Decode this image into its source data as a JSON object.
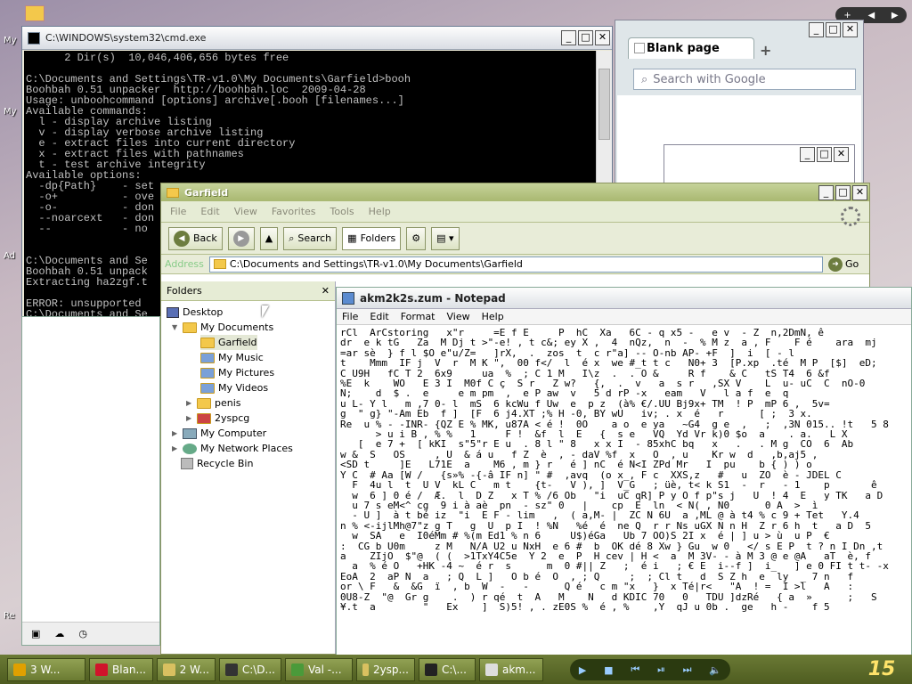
{
  "desktop": {
    "labels": [
      "My",
      "My",
      "Ad",
      "Re"
    ]
  },
  "cmd": {
    "title": "C:\\WINDOWS\\system32\\cmd.exe",
    "lines": [
      "      2 Dir(s)  10,046,406,656 bytes free",
      "",
      "C:\\Documents and Settings\\TR-v1.0\\My Documents\\Garfield>booh",
      "Boohbah 0.51 unpacker  http://boohbah.loc  2009-04-28",
      "Usage: unboohcommand [options] archive[.booh [filenames...]",
      "Available commands:",
      "  l - display archive listing",
      "  v - display verbose archive listing",
      "  e - extract files into current directory",
      "  x - extract files with pathnames",
      "  t - test archive integrity",
      "Available options:",
      "  -dp{Path}    - set",
      "  -o+          - ove",
      "  -o-          - don",
      "  --noarcext   - don",
      "  --           - no ",
      "",
      "",
      "C:\\Documents and Se",
      "Boohbah 0.51 unpack",
      "Extracting ha2zgf.t",
      "",
      "ERROR: unsupported",
      "C:\\Documents and Se"
    ]
  },
  "chrome": {
    "tab": "Blank page",
    "new_tab": "+",
    "search_placeholder": "Search with Google"
  },
  "explorer": {
    "title": "Garfield",
    "menu": [
      "File",
      "Edit",
      "View",
      "Favorites",
      "Tools",
      "Help"
    ],
    "back": "Back",
    "search": "Search",
    "folders": "Folders",
    "address_label": "Address",
    "address": "C:\\Documents and Settings\\TR-v1.0\\My Documents\\Garfield",
    "go": "Go",
    "pane_title": "Folders",
    "tree": [
      "Desktop",
      "My Documents",
      "Garfield",
      "My Music",
      "My Pictures",
      "My Videos",
      "penis",
      "2yspcg",
      "My Computer",
      "My Network Places",
      "Recycle Bin"
    ]
  },
  "notepad": {
    "title": "akm2k2s.zum - Notepad",
    "menu": [
      "File",
      "Edit",
      "Format",
      "View",
      "Help"
    ],
    "lines": [
      "rCl  ArCstoring   x\"r     =E f E     P  hC  Xa   6C - q x5 -   e v  - Z  n,2DmN, ê",
      "dr  e k tG   Za  M Dj t >\"-e! , t c&; ey X ,  4  nQz,  n  -  % M z  a , F    F é    ara  mj",
      "=ar sè  } f l $O e\"u/Z=   ]rX,  .  zos  t  c r\"a] -- O-nb AP- +F  ]  i  [ - l     ",
      "t    Mmm  IF j  V  r  M K \",  00 f</  l  é x  we #_t t c   N0+ 3  [P.xp  .té  M P  [$]  eD;",
      "C U9H   fC T 2  6x9     ua  %  ; C 1 M   I\\z  .  . O &     R f    & C   tS T4  6 &f",
      "%E  k    WO   E 3 I  M0f C ç  S r   Z w?   {,  .  v   a  s r   ,SX V    L  u- uC  C  nO-0",
      "N;    d  $ .  e     e m pm  ,  e P aw  v   5 d rP -x   eam   V   l a f  e  q  ",
      "u L- Y l   m ,7 0- l  mS  6 kcWu f Uw  e  p z  (à% €/.UU Bj9x+ TM  ! P  mP 6 ,  5v=",
      "g  \" g} \"-Am Eb  f ]  [F  6 j4.XT ;% H -0, BY wU   iv; . x  é   r      [ ;  3 x.  ",
      "Re  u % - -INR- {QZ E % MK, u87A < é !  0O    a o  e ya   ~G4  g e  ,   ;  ,3N 015.. !t   5 8",
      "      > u i B , % %   1     F !  &f  l  E   {  s e   VQ  Yd Vr k)0 $o  a    . a.   L X",
      "   [  e 7 +  [ kKI  s\"5\"r E u  . 8 l \" 8   x x I  - 85xhC bq   x   .   . M g  CO  6  Ab",
      "w &  S   OS     , U  & á u   f Z  è  , - daV %f  x   O  , u    Kr w  d   ,b,aj5 ,",
      "<SD t     ]E   L71E  a    M6 , m } r   é ] nC  é N<I ZPd Mr   I  pu    b { ) ) o",
      "Y C  # Aa [W /   {s»% -{-â IF n] \" #  ,avq  (o x_, F c  XXS,z   #   u  ZO  è - JDEL C",
      "  F  4u l  t  U V  kL C   m t    {t-   V ), ]  V_G   ; üè, t< k S1  -  r   - 1    p       ê",
      "  w  6 ] 0 é /  Æ.  l  D Z   x T % /6 Ob   \"i  uC qR] P y O f p\"s j   U  ! 4  E   y TK   a D",
      "  u 7 s eM<^ cg  9 i à aè  pn  - sz\" 0   |    cp  E  ln  < N( , N0      0 A  >  ì ",
      "  - U ]  à t bé iz  \"i  E F - lim   ,  ( a,M- |  ZC N 6U  a ,ML @ à t4 % c 9 + Tet   Y.4",
      "n % <-ijlMh@7\"z g T   g  U  p I  ! %N   %é  é  ne Q  r r Ns uGX N n H  Z r 6 h  t   a D  5",
      "  w  SA   e  I0éMm # %(m Ed1 % n 6     U$)éGa   Ub 7 OO)S 2I x  é | ] u > ù  u P  €",
      ":  CG b U0m     z M   N/A U2 u NxH  e 6 #  b  OK dé 8 Xw } Gu  w 0   </ s E P  t ? n I Dn ,t",
      "a    ZIjO  $\"@  ( (  >1TxY4C5e  Y 2  e  P  H cev | H <  a  M 3V- - à M 3 @ e @A   aT  è, f",
      "  a  % é O   +HK -4 ~  é r  s      m  0 #|| Z   ;  é i   ; € E  i--f ]  i_   ] e 0 FI t t- -x",
      "EoA  2  aP N  a   ; Q  L ]   O b é  O  , ; Q     ;  ; Cl t   d  S Z h  e  ly  _ 7 n   f",
      "or \\ F   &  &G  ï  , b  W  -   -      Q é   c m \"x   }  x Té|r<   \"A  ! =  I >l   A   : ",
      "0U8-Z  \"@  Gr g    .  ) r qé  t  A   M    N   d KDIC 70   0   TDU ]dzRé   { a  »      ;   S",
      "¥.t  a        \"   Ex    ]  S)5! , . zE0S %  é , %    ,Y  qJ u 0b .  ge   h -    f 5  "
    ]
  },
  "taskbar": {
    "items": [
      "3 W...",
      "Blan...",
      "2 W...",
      "C:\\D...",
      "Val -...",
      "2ysp...",
      "C:\\...",
      "akm..."
    ],
    "colors": [
      "#e0a000",
      "#d0142b",
      "#d9c060",
      "#333333",
      "#4a9a3a",
      "#d9c060",
      "#222222",
      "#dddddd"
    ],
    "clock": "15"
  }
}
